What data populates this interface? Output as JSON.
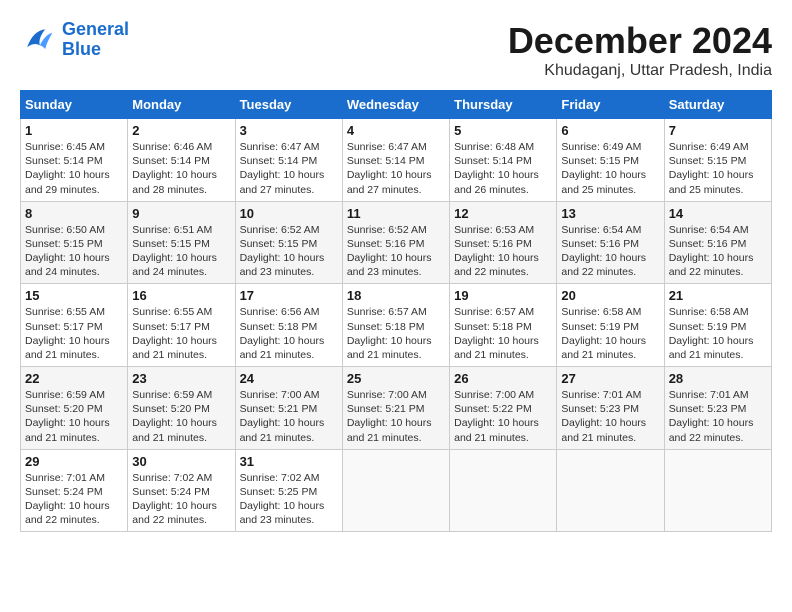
{
  "logo": {
    "line1": "General",
    "line2": "Blue"
  },
  "title": "December 2024",
  "subtitle": "Khudaganj, Uttar Pradesh, India",
  "days_of_week": [
    "Sunday",
    "Monday",
    "Tuesday",
    "Wednesday",
    "Thursday",
    "Friday",
    "Saturday"
  ],
  "weeks": [
    [
      {
        "day": "1",
        "sunrise": "6:45 AM",
        "sunset": "5:14 PM",
        "daylight": "10 hours and 29 minutes."
      },
      {
        "day": "2",
        "sunrise": "6:46 AM",
        "sunset": "5:14 PM",
        "daylight": "10 hours and 28 minutes."
      },
      {
        "day": "3",
        "sunrise": "6:47 AM",
        "sunset": "5:14 PM",
        "daylight": "10 hours and 27 minutes."
      },
      {
        "day": "4",
        "sunrise": "6:47 AM",
        "sunset": "5:14 PM",
        "daylight": "10 hours and 27 minutes."
      },
      {
        "day": "5",
        "sunrise": "6:48 AM",
        "sunset": "5:14 PM",
        "daylight": "10 hours and 26 minutes."
      },
      {
        "day": "6",
        "sunrise": "6:49 AM",
        "sunset": "5:15 PM",
        "daylight": "10 hours and 25 minutes."
      },
      {
        "day": "7",
        "sunrise": "6:49 AM",
        "sunset": "5:15 PM",
        "daylight": "10 hours and 25 minutes."
      }
    ],
    [
      {
        "day": "8",
        "sunrise": "6:50 AM",
        "sunset": "5:15 PM",
        "daylight": "10 hours and 24 minutes."
      },
      {
        "day": "9",
        "sunrise": "6:51 AM",
        "sunset": "5:15 PM",
        "daylight": "10 hours and 24 minutes."
      },
      {
        "day": "10",
        "sunrise": "6:52 AM",
        "sunset": "5:15 PM",
        "daylight": "10 hours and 23 minutes."
      },
      {
        "day": "11",
        "sunrise": "6:52 AM",
        "sunset": "5:16 PM",
        "daylight": "10 hours and 23 minutes."
      },
      {
        "day": "12",
        "sunrise": "6:53 AM",
        "sunset": "5:16 PM",
        "daylight": "10 hours and 22 minutes."
      },
      {
        "day": "13",
        "sunrise": "6:54 AM",
        "sunset": "5:16 PM",
        "daylight": "10 hours and 22 minutes."
      },
      {
        "day": "14",
        "sunrise": "6:54 AM",
        "sunset": "5:16 PM",
        "daylight": "10 hours and 22 minutes."
      }
    ],
    [
      {
        "day": "15",
        "sunrise": "6:55 AM",
        "sunset": "5:17 PM",
        "daylight": "10 hours and 21 minutes."
      },
      {
        "day": "16",
        "sunrise": "6:55 AM",
        "sunset": "5:17 PM",
        "daylight": "10 hours and 21 minutes."
      },
      {
        "day": "17",
        "sunrise": "6:56 AM",
        "sunset": "5:18 PM",
        "daylight": "10 hours and 21 minutes."
      },
      {
        "day": "18",
        "sunrise": "6:57 AM",
        "sunset": "5:18 PM",
        "daylight": "10 hours and 21 minutes."
      },
      {
        "day": "19",
        "sunrise": "6:57 AM",
        "sunset": "5:18 PM",
        "daylight": "10 hours and 21 minutes."
      },
      {
        "day": "20",
        "sunrise": "6:58 AM",
        "sunset": "5:19 PM",
        "daylight": "10 hours and 21 minutes."
      },
      {
        "day": "21",
        "sunrise": "6:58 AM",
        "sunset": "5:19 PM",
        "daylight": "10 hours and 21 minutes."
      }
    ],
    [
      {
        "day": "22",
        "sunrise": "6:59 AM",
        "sunset": "5:20 PM",
        "daylight": "10 hours and 21 minutes."
      },
      {
        "day": "23",
        "sunrise": "6:59 AM",
        "sunset": "5:20 PM",
        "daylight": "10 hours and 21 minutes."
      },
      {
        "day": "24",
        "sunrise": "7:00 AM",
        "sunset": "5:21 PM",
        "daylight": "10 hours and 21 minutes."
      },
      {
        "day": "25",
        "sunrise": "7:00 AM",
        "sunset": "5:21 PM",
        "daylight": "10 hours and 21 minutes."
      },
      {
        "day": "26",
        "sunrise": "7:00 AM",
        "sunset": "5:22 PM",
        "daylight": "10 hours and 21 minutes."
      },
      {
        "day": "27",
        "sunrise": "7:01 AM",
        "sunset": "5:23 PM",
        "daylight": "10 hours and 21 minutes."
      },
      {
        "day": "28",
        "sunrise": "7:01 AM",
        "sunset": "5:23 PM",
        "daylight": "10 hours and 22 minutes."
      }
    ],
    [
      {
        "day": "29",
        "sunrise": "7:01 AM",
        "sunset": "5:24 PM",
        "daylight": "10 hours and 22 minutes."
      },
      {
        "day": "30",
        "sunrise": "7:02 AM",
        "sunset": "5:24 PM",
        "daylight": "10 hours and 22 minutes."
      },
      {
        "day": "31",
        "sunrise": "7:02 AM",
        "sunset": "5:25 PM",
        "daylight": "10 hours and 23 minutes."
      },
      null,
      null,
      null,
      null
    ]
  ]
}
